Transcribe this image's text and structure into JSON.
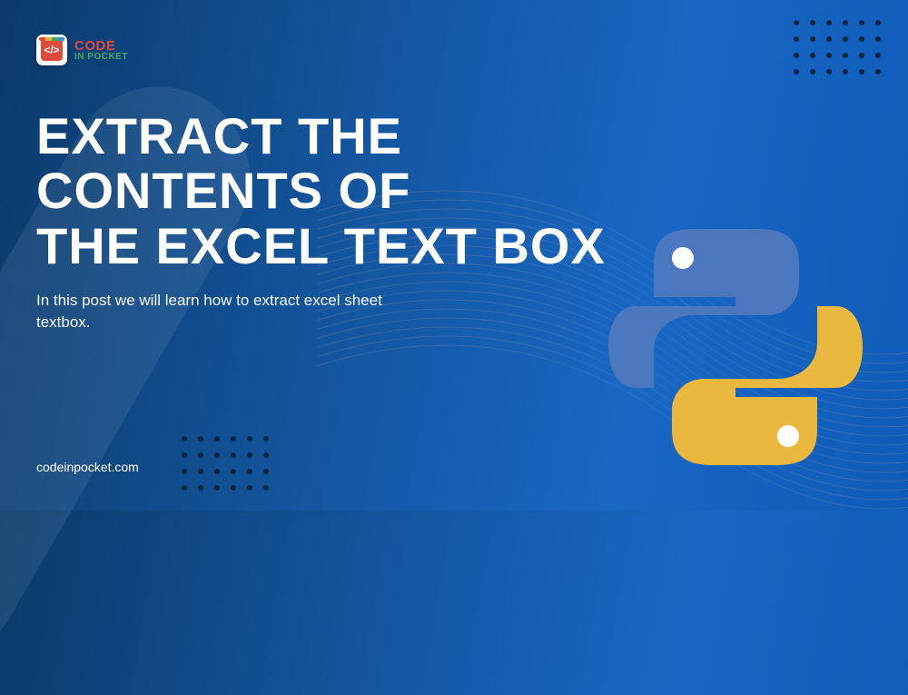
{
  "logo": {
    "brand_top": "CODE",
    "brand_bottom": "IN POCKET",
    "icon_glyph": "</>"
  },
  "heading": {
    "line1": "EXTRACT THE",
    "line2": "CONTENTS OF",
    "line3": "THE EXCEL TEXT BOX"
  },
  "subheading": "In this post we will learn how to extract excel sheet textbox.",
  "footer_url": "codeinpocket.com",
  "colors": {
    "bg_start": "#0a3a6a",
    "bg_end": "#1966c4",
    "python_blue": "#4b77be",
    "python_yellow": "#eab83e",
    "accent_red": "#e14b3b",
    "accent_green": "#4aa55e"
  }
}
